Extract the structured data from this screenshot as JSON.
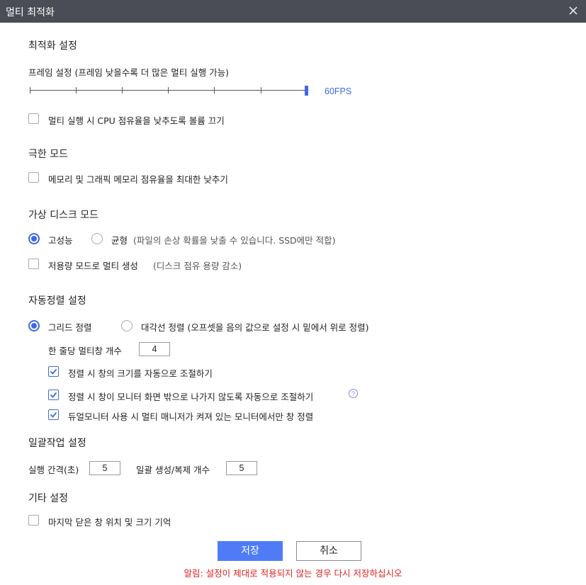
{
  "window": {
    "title": "멀티 최적화",
    "close_icon": "close-icon"
  },
  "optimize": {
    "heading": "최적화 설정",
    "frame_label": "프레임 설정 (프레임 낮을수록 더 많은 멀티 실행 가능)",
    "fps_value": "60FPS",
    "fps_level": 1.0,
    "mute_label": "멀티 실행 시 CPU 점유율을 낮추도록 볼륨 끄기",
    "mute_checked": false
  },
  "extreme": {
    "heading": "극한 모드",
    "memory_label": "메모리 및 그래픽 메모리 점유율을 최대한 낮추기",
    "memory_checked": false
  },
  "vdisk": {
    "heading": "가상 디스크 모드",
    "high_perf_label": "고성능",
    "balanced_label": "균형",
    "balanced_note": "(파일의 손상 확률을 낮출 수 있습니다. SSD에만 적합)",
    "selected": "고성능",
    "low_capacity_label": "저용량 모드로 멀티 생성",
    "low_capacity_note": "(디스크 점유 용량 감소)",
    "low_capacity_checked": false
  },
  "arrange": {
    "heading": "자동정렬 설정",
    "grid_label": "그리드 정렬",
    "diagonal_label": "대각선 정렬 (오프셋을 음의 값으로 설정 시 밑에서 위로 정렬)",
    "selected": "그리드 정렬",
    "per_row_label": "한 줄당 멀티창 개수",
    "per_row_value": "4",
    "opt_resize_label": "정렬 시 창의 크기를 자동으로 조절하기",
    "opt_offscreen_label": "정렬 시 창이 모니터 화면 밖으로 나가지 않도록 자동으로 조절하기",
    "opt_dual_label": "듀얼모니터 사용 시 멀티 매니저가 켜져 있는 모니터에서만 창 정렬",
    "help_glyph": "?"
  },
  "batch": {
    "heading": "일괄작업 설정",
    "interval_label": "실행 간격(초)",
    "interval_value": "5",
    "count_label": "일괄 생성/복제 개수",
    "count_value": "5"
  },
  "misc": {
    "heading": "기타 설정",
    "remember_label": "마지막 닫은 창 위치 및 크기 기억",
    "remember_checked": false
  },
  "footer": {
    "save_label": "저장",
    "cancel_label": "취소",
    "warning": "알림: 설정이 제대로 적용되지 않는 경우 다시 저장하십시오"
  },
  "colors": {
    "accent": "#3f69e8",
    "titlebar": "#4a4d55",
    "warning": "#e02020"
  }
}
